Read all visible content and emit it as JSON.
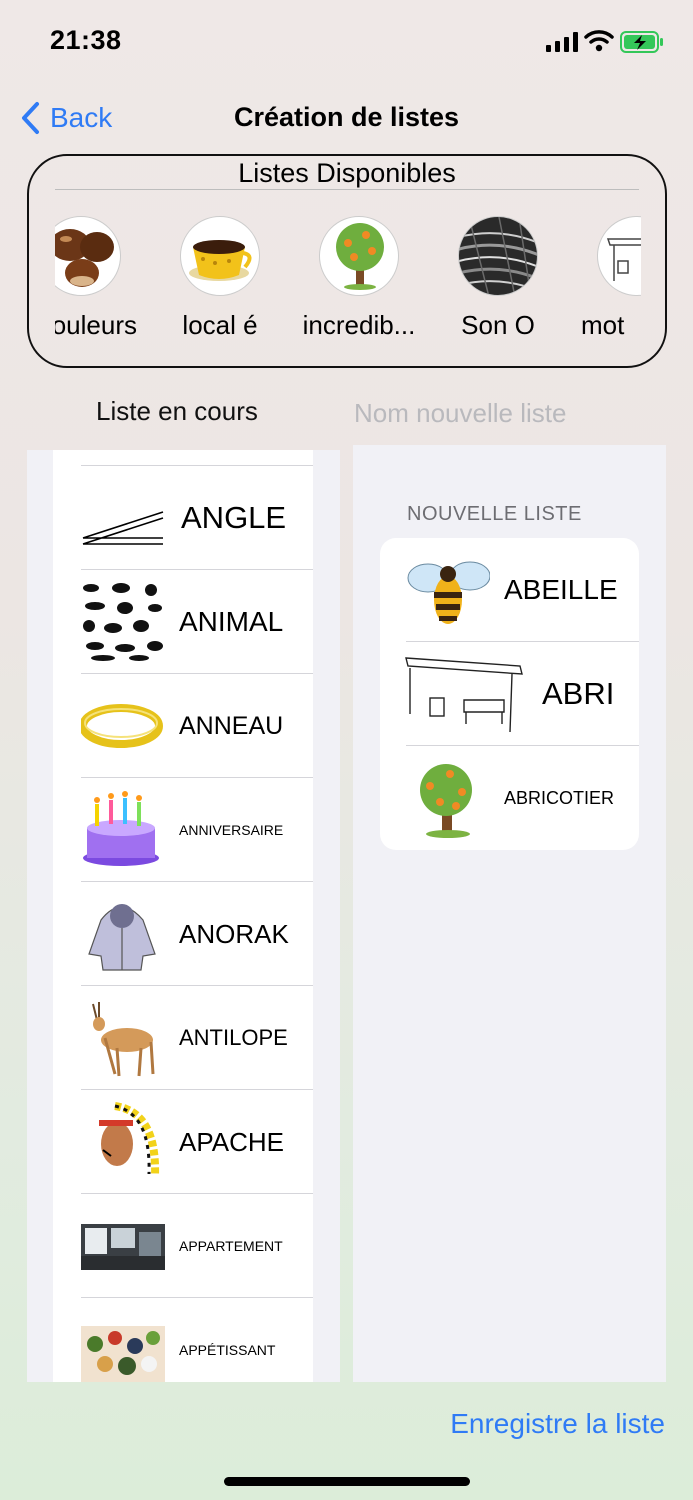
{
  "status_bar": {
    "time": "21:38"
  },
  "nav": {
    "back_label": "Back",
    "title": "Création de listes"
  },
  "available_lists": {
    "title": "Listes Disponibles",
    "items": [
      {
        "name": "couleurs",
        "icon": "chestnut-thumbnail"
      },
      {
        "name": "local é",
        "icon": "coffee-cup-thumbnail"
      },
      {
        "name": "incredib...",
        "icon": "apricot-tree-thumbnail"
      },
      {
        "name": "Son O",
        "icon": "texture-photo-thumbnail"
      },
      {
        "name": "mot",
        "icon": "bus-shelter-thumbnail"
      }
    ]
  },
  "current_list": {
    "label": "Liste en cours",
    "words": [
      {
        "word": "ANGLE",
        "icon": "angle-icon"
      },
      {
        "word": "ANIMAL",
        "icon": "animals-silhouette-icon"
      },
      {
        "word": "ANNEAU",
        "icon": "ring-icon"
      },
      {
        "word": "ANNIVERSAIRE",
        "icon": "birthday-cake-icon"
      },
      {
        "word": "ANORAK",
        "icon": "anorak-icon"
      },
      {
        "word": "ANTILOPE",
        "icon": "antelope-icon"
      },
      {
        "word": "APACHE",
        "icon": "apache-headdress-icon"
      },
      {
        "word": "APPARTEMENT",
        "icon": "apartment-photo-icon"
      },
      {
        "word": "APPÉTISSANT",
        "icon": "food-platter-icon"
      }
    ]
  },
  "new_list": {
    "name_placeholder": "Nom nouvelle liste",
    "header": "NOUVELLE LISTE",
    "words": [
      {
        "word": "ABEILLE",
        "icon": "bee-icon"
      },
      {
        "word": "ABRI",
        "icon": "bus-shelter-icon"
      },
      {
        "word": "ABRICOTIER",
        "icon": "apricot-tree-icon"
      }
    ]
  },
  "save_label": "Enregistre la liste",
  "colors": {
    "accent": "#2f7bf5",
    "battery_green": "#34c759"
  }
}
